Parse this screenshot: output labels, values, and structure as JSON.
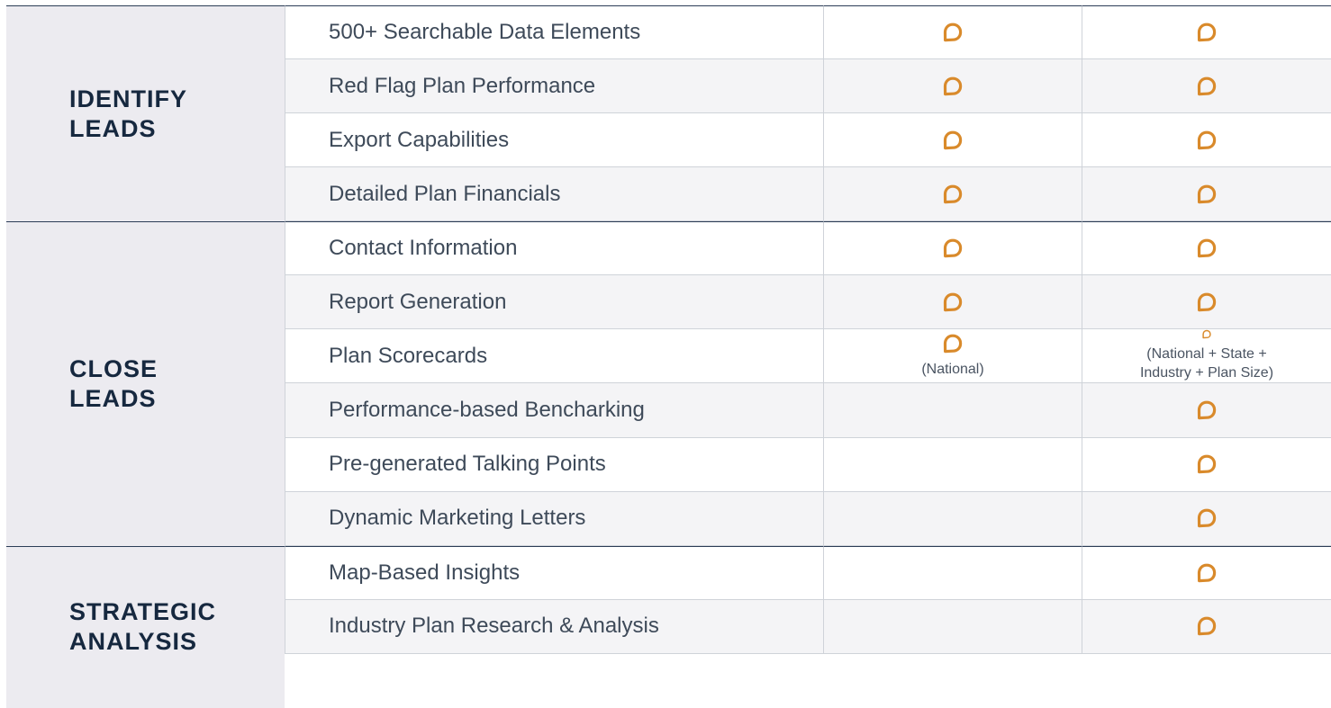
{
  "colors": {
    "accent": "#d98a2b",
    "heading": "#16283f",
    "section_bg": "#ecebf0"
  },
  "sections": [
    {
      "id": "identify",
      "label": "IDENTIFY\nLEADS"
    },
    {
      "id": "close",
      "label": "CLOSE\nLEADS"
    },
    {
      "id": "strategic",
      "label": "STRATEGIC\nANALYSIS"
    }
  ],
  "rows": [
    {
      "feature": "500+ Searchable Data Elements",
      "col1": true,
      "col2": true
    },
    {
      "feature": "Red Flag Plan Performance",
      "col1": true,
      "col2": true
    },
    {
      "feature": "Export Capabilities",
      "col1": true,
      "col2": true
    },
    {
      "feature": "Detailed Plan Financials",
      "col1": true,
      "col2": true
    },
    {
      "feature": "Contact Information",
      "col1": true,
      "col2": true
    },
    {
      "feature": "Report Generation",
      "col1": true,
      "col2": true
    },
    {
      "feature": "Plan Scorecards",
      "col1": true,
      "col2": true,
      "col1_note": "(National)",
      "col2_note": "(National + State +\nIndustry + Plan Size)"
    },
    {
      "feature": "Performance-based Bencharking",
      "col1": false,
      "col2": true
    },
    {
      "feature": "Pre-generated Talking Points",
      "col1": false,
      "col2": true
    },
    {
      "feature": "Dynamic Marketing Letters",
      "col1": false,
      "col2": true
    },
    {
      "feature": "Map-Based Insights",
      "col1": false,
      "col2": true
    },
    {
      "feature": "Industry Plan Research & Analysis",
      "col1": false,
      "col2": true
    }
  ],
  "icon": "speech-bubble-icon"
}
